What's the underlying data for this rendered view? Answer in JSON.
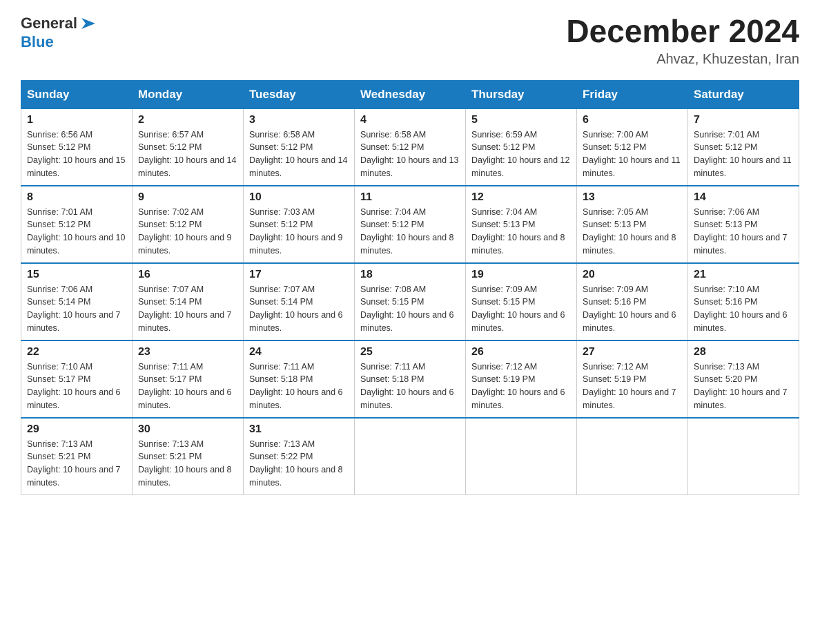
{
  "header": {
    "logo_general": "General",
    "logo_blue": "Blue",
    "month_title": "December 2024",
    "location": "Ahvaz, Khuzestan, Iran"
  },
  "weekdays": [
    "Sunday",
    "Monday",
    "Tuesday",
    "Wednesday",
    "Thursday",
    "Friday",
    "Saturday"
  ],
  "weeks": [
    [
      {
        "day": "1",
        "sunrise": "6:56 AM",
        "sunset": "5:12 PM",
        "daylight": "10 hours and 15 minutes."
      },
      {
        "day": "2",
        "sunrise": "6:57 AM",
        "sunset": "5:12 PM",
        "daylight": "10 hours and 14 minutes."
      },
      {
        "day": "3",
        "sunrise": "6:58 AM",
        "sunset": "5:12 PM",
        "daylight": "10 hours and 14 minutes."
      },
      {
        "day": "4",
        "sunrise": "6:58 AM",
        "sunset": "5:12 PM",
        "daylight": "10 hours and 13 minutes."
      },
      {
        "day": "5",
        "sunrise": "6:59 AM",
        "sunset": "5:12 PM",
        "daylight": "10 hours and 12 minutes."
      },
      {
        "day": "6",
        "sunrise": "7:00 AM",
        "sunset": "5:12 PM",
        "daylight": "10 hours and 11 minutes."
      },
      {
        "day": "7",
        "sunrise": "7:01 AM",
        "sunset": "5:12 PM",
        "daylight": "10 hours and 11 minutes."
      }
    ],
    [
      {
        "day": "8",
        "sunrise": "7:01 AM",
        "sunset": "5:12 PM",
        "daylight": "10 hours and 10 minutes."
      },
      {
        "day": "9",
        "sunrise": "7:02 AM",
        "sunset": "5:12 PM",
        "daylight": "10 hours and 9 minutes."
      },
      {
        "day": "10",
        "sunrise": "7:03 AM",
        "sunset": "5:12 PM",
        "daylight": "10 hours and 9 minutes."
      },
      {
        "day": "11",
        "sunrise": "7:04 AM",
        "sunset": "5:12 PM",
        "daylight": "10 hours and 8 minutes."
      },
      {
        "day": "12",
        "sunrise": "7:04 AM",
        "sunset": "5:13 PM",
        "daylight": "10 hours and 8 minutes."
      },
      {
        "day": "13",
        "sunrise": "7:05 AM",
        "sunset": "5:13 PM",
        "daylight": "10 hours and 8 minutes."
      },
      {
        "day": "14",
        "sunrise": "7:06 AM",
        "sunset": "5:13 PM",
        "daylight": "10 hours and 7 minutes."
      }
    ],
    [
      {
        "day": "15",
        "sunrise": "7:06 AM",
        "sunset": "5:14 PM",
        "daylight": "10 hours and 7 minutes."
      },
      {
        "day": "16",
        "sunrise": "7:07 AM",
        "sunset": "5:14 PM",
        "daylight": "10 hours and 7 minutes."
      },
      {
        "day": "17",
        "sunrise": "7:07 AM",
        "sunset": "5:14 PM",
        "daylight": "10 hours and 6 minutes."
      },
      {
        "day": "18",
        "sunrise": "7:08 AM",
        "sunset": "5:15 PM",
        "daylight": "10 hours and 6 minutes."
      },
      {
        "day": "19",
        "sunrise": "7:09 AM",
        "sunset": "5:15 PM",
        "daylight": "10 hours and 6 minutes."
      },
      {
        "day": "20",
        "sunrise": "7:09 AM",
        "sunset": "5:16 PM",
        "daylight": "10 hours and 6 minutes."
      },
      {
        "day": "21",
        "sunrise": "7:10 AM",
        "sunset": "5:16 PM",
        "daylight": "10 hours and 6 minutes."
      }
    ],
    [
      {
        "day": "22",
        "sunrise": "7:10 AM",
        "sunset": "5:17 PM",
        "daylight": "10 hours and 6 minutes."
      },
      {
        "day": "23",
        "sunrise": "7:11 AM",
        "sunset": "5:17 PM",
        "daylight": "10 hours and 6 minutes."
      },
      {
        "day": "24",
        "sunrise": "7:11 AM",
        "sunset": "5:18 PM",
        "daylight": "10 hours and 6 minutes."
      },
      {
        "day": "25",
        "sunrise": "7:11 AM",
        "sunset": "5:18 PM",
        "daylight": "10 hours and 6 minutes."
      },
      {
        "day": "26",
        "sunrise": "7:12 AM",
        "sunset": "5:19 PM",
        "daylight": "10 hours and 6 minutes."
      },
      {
        "day": "27",
        "sunrise": "7:12 AM",
        "sunset": "5:19 PM",
        "daylight": "10 hours and 7 minutes."
      },
      {
        "day": "28",
        "sunrise": "7:13 AM",
        "sunset": "5:20 PM",
        "daylight": "10 hours and 7 minutes."
      }
    ],
    [
      {
        "day": "29",
        "sunrise": "7:13 AM",
        "sunset": "5:21 PM",
        "daylight": "10 hours and 7 minutes."
      },
      {
        "day": "30",
        "sunrise": "7:13 AM",
        "sunset": "5:21 PM",
        "daylight": "10 hours and 8 minutes."
      },
      {
        "day": "31",
        "sunrise": "7:13 AM",
        "sunset": "5:22 PM",
        "daylight": "10 hours and 8 minutes."
      },
      null,
      null,
      null,
      null
    ]
  ]
}
